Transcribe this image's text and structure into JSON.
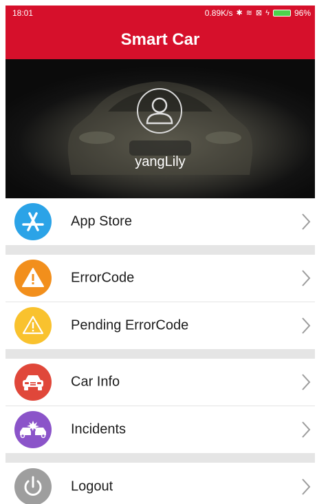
{
  "status_bar": {
    "time": "18:01",
    "network_speed": "0.89K/s",
    "battery": "96%",
    "icons": [
      "bluetooth-icon",
      "wifi-icon",
      "sim-icon",
      "charging-icon",
      "battery-icon"
    ]
  },
  "header": {
    "title": "Smart Car"
  },
  "profile": {
    "username": "yangLily",
    "avatar_icon": "user-avatar-icon"
  },
  "menu": {
    "items": [
      {
        "label": "App Store",
        "icon": "app-store-icon",
        "color": "#2ba3e7"
      },
      {
        "label": "ErrorCode",
        "icon": "warning-icon",
        "color": "#f28f1c"
      },
      {
        "label": "Pending ErrorCode",
        "icon": "warning-outline-icon",
        "color": "#f9c22e"
      },
      {
        "label": "Car Info",
        "icon": "car-icon",
        "color": "#e0473a"
      },
      {
        "label": "Incidents",
        "icon": "crash-icon",
        "color": "#8b54c9"
      },
      {
        "label": "Logout",
        "icon": "power-icon",
        "color": "#9e9e9e"
      }
    ]
  },
  "colors": {
    "brand_red": "#d6102b",
    "separator": "#e5e5e5"
  }
}
